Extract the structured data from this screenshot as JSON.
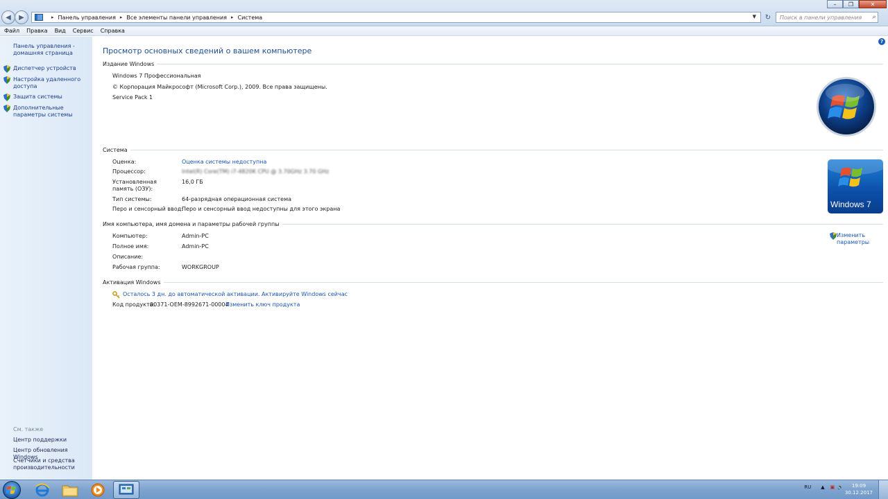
{
  "window": {
    "breadcrumb": [
      "Панель управления",
      "Все элементы панели управления",
      "Система"
    ],
    "search_placeholder": "Поиск в панели управления"
  },
  "menu": [
    "Файл",
    "Правка",
    "Вид",
    "Сервис",
    "Справка"
  ],
  "sidebar": {
    "home": "Панель управления - домашняя страница",
    "items": [
      "Диспетчер устройств",
      "Настройка удаленного доступа",
      "Защита системы",
      "Дополнительные параметры системы"
    ],
    "see_also_title": "См. также",
    "see_also": [
      "Центр поддержки",
      "Центр обновления Windows",
      "Счетчики и средства производительности"
    ]
  },
  "main": {
    "title": "Просмотр основных сведений о вашем компьютере",
    "edition": {
      "header": "Издание Windows",
      "name": "Windows 7 Профессиональная",
      "copyright": "© Корпорация Майкрософт (Microsoft Corp.), 2009. Все права защищены.",
      "service_pack": "Service Pack 1"
    },
    "system": {
      "header": "Система",
      "rows": [
        {
          "label": "Оценка:",
          "value": "Оценка системы недоступна"
        },
        {
          "label": "Процессор:",
          "value": "Intel(R) Core(TM) i7-4820K CPU @ 3.70GHz   3.70 GHz"
        },
        {
          "label": "Установленная память (ОЗУ):",
          "value": "16,0 ГБ"
        },
        {
          "label": "Тип системы:",
          "value": "64-разрядная операционная система"
        },
        {
          "label": "Перо и сенсорный ввод:",
          "value": "Перо и сенсорный ввод недоступны для этого экрана"
        }
      ],
      "logo_text": "Windows 7"
    },
    "computer": {
      "header": "Имя компьютера, имя домена и параметры рабочей группы",
      "rows": [
        {
          "label": "Компьютер:",
          "value": "Admin-PC"
        },
        {
          "label": "Полное имя:",
          "value": "Admin-PC"
        },
        {
          "label": "Описание:",
          "value": ""
        },
        {
          "label": "Рабочая группа:",
          "value": "WORKGROUP"
        }
      ],
      "change_link": "Изменить параметры"
    },
    "activation": {
      "header": "Активация Windows",
      "notice": "Осталось 3 дн. до автоматической активации. Активируйте Windows сейчас",
      "product_key_label": "Код продукта:",
      "product_key": "00371-OEM-8992671-00004",
      "change_key_link": "Изменить ключ продукта"
    }
  },
  "taskbar": {
    "lang": "RU",
    "time": "19:09",
    "date": "30.12.2017"
  }
}
